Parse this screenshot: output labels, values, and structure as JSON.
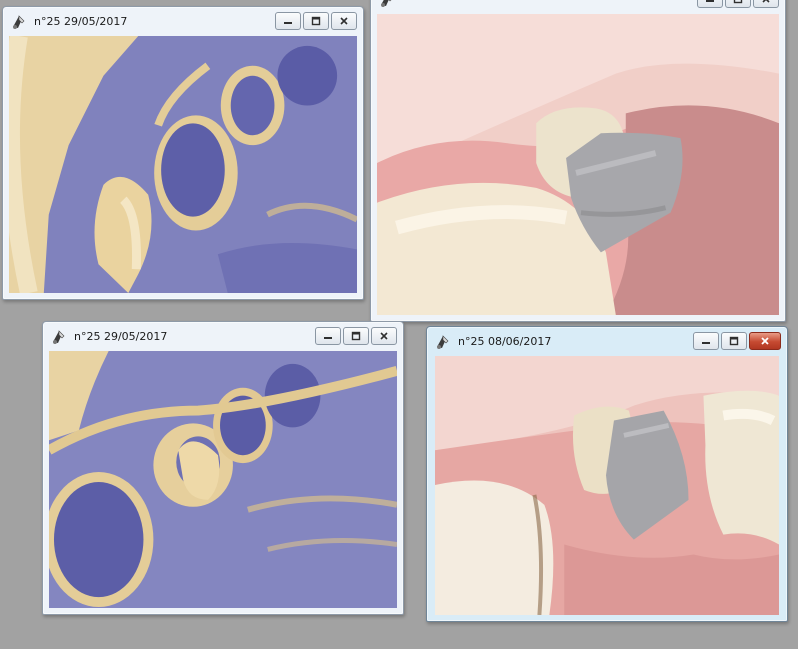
{
  "windows": [
    {
      "id": "w1",
      "title": "n°25 29/05/2017",
      "image": "impression-tray-photo",
      "active": false
    },
    {
      "id": "w2",
      "title": "",
      "image": "intraoral-implant-abutment-photo",
      "active": false
    },
    {
      "id": "w3",
      "title": "n°25 29/05/2017",
      "image": "impression-tray-photo",
      "active": false
    },
    {
      "id": "w4",
      "title": "n°25 08/06/2017",
      "image": "intraoral-implant-abutment-photo",
      "active": true
    }
  ],
  "colors": {
    "desktop": "#a2a2a2",
    "impression_purple": "#6d6fb2",
    "impression_cream": "#e6cf9c",
    "gum_pink": "#e9a8a6",
    "abutment_gray": "#a8a8ab",
    "close_red": "#c64a31"
  },
  "icons": [
    "camera-app-icon",
    "minimize-icon",
    "maximize-icon",
    "close-icon"
  ]
}
